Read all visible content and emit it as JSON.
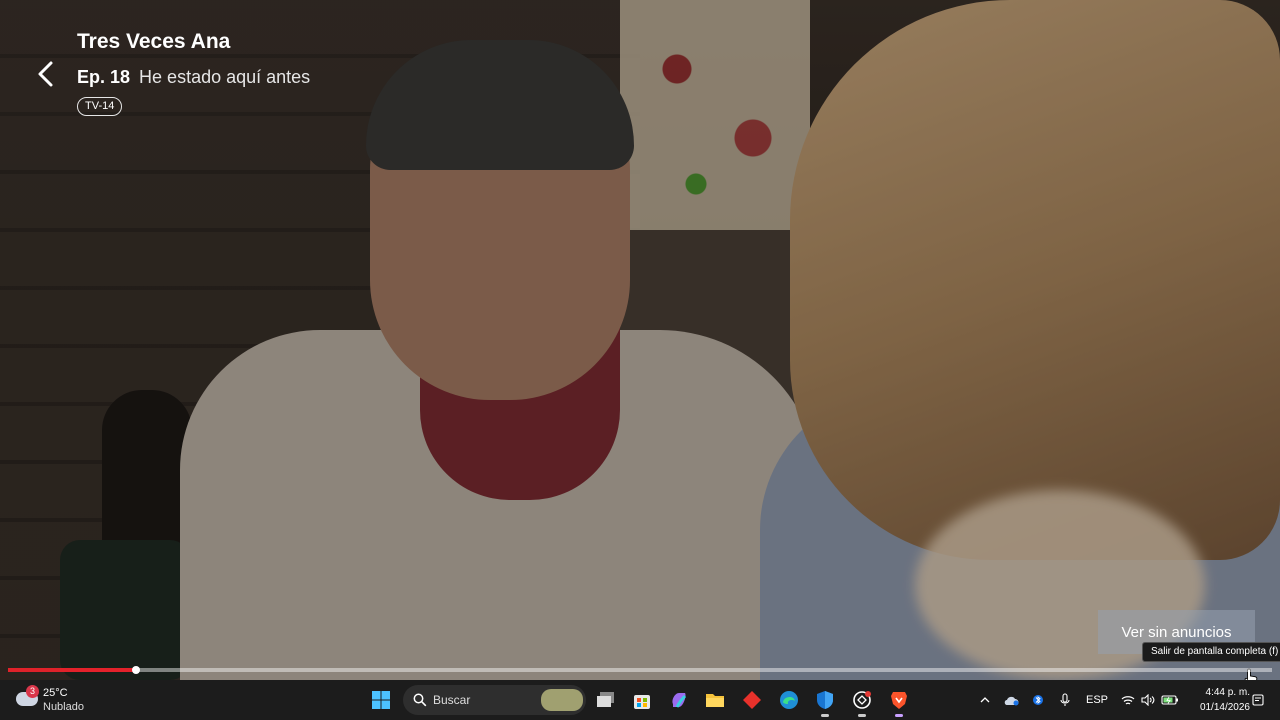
{
  "player": {
    "show_title": "Tres Veces Ana",
    "episode_number": "Ep. 18",
    "episode_name": "He estado aquí antes",
    "rating": "TV-14",
    "ad_free_button": "Ver sin anuncios",
    "fullscreen_tooltip": "Salir de pantalla completa (f)",
    "progress_fraction": 0.101,
    "accent_color": "#e1222a"
  },
  "taskbar": {
    "weather": {
      "badge": "3",
      "temperature": "25°C",
      "condition": "Nublado"
    },
    "search_placeholder": "Buscar",
    "apps": [
      "windows-start",
      "search",
      "task-view",
      "microsoft-store",
      "copilot",
      "file-explorer",
      "red-app",
      "edge",
      "defender",
      "chatgpt",
      "brave"
    ],
    "tray": {
      "language": "ESP"
    },
    "clock": {
      "time": "4:44 p. m.",
      "date": "01/14/2026"
    }
  }
}
